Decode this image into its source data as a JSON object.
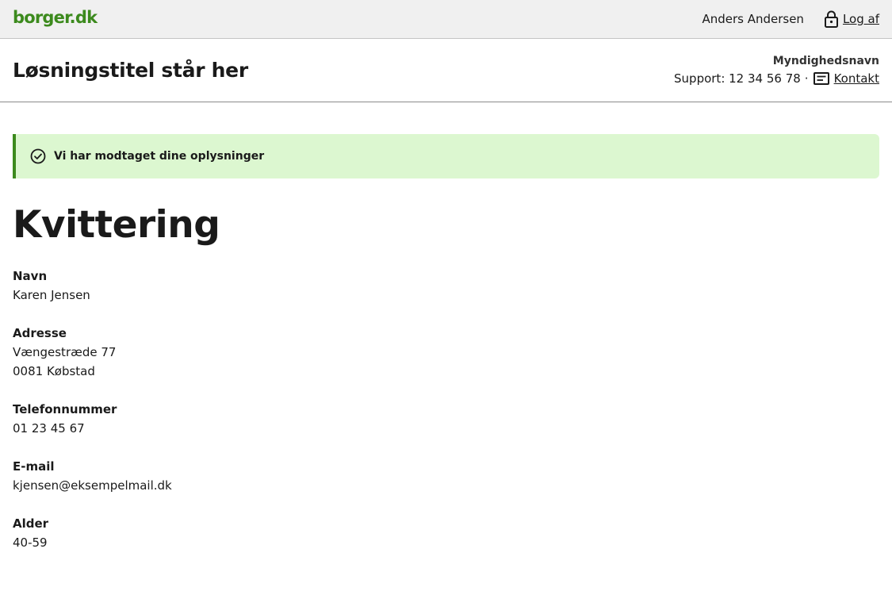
{
  "topbar": {
    "logo": "borger.dk",
    "user_name": "Anders Andersen",
    "logout_label": "Log af",
    "icons": {
      "logout": "lock-icon"
    }
  },
  "solution": {
    "title": "Løsningstitel står her",
    "authority_name": "Myndighedsnavn",
    "support_text": "Support: 12 34 56 78",
    "separator": "·",
    "contact_label": "Kontakt",
    "icons": {
      "contact": "message-icon"
    }
  },
  "alert": {
    "message": "Vi har modtaget dine oplysninger",
    "icon": "check-circle-icon",
    "background": "#dcf7d0",
    "accent": "#3c8a1d"
  },
  "page": {
    "heading": "Kvittering"
  },
  "fields": [
    {
      "label": "Navn",
      "lines": [
        "Karen Jensen"
      ]
    },
    {
      "label": "Adresse",
      "lines": [
        "Vængestræde 77",
        "0081 Købstad"
      ]
    },
    {
      "label": "Telefonnummer",
      "lines": [
        "01 23 45 67"
      ]
    },
    {
      "label": "E-mail",
      "lines": [
        "kjensen@eksempelmail.dk"
      ]
    },
    {
      "label": "Alder",
      "lines": [
        "40-59"
      ]
    }
  ],
  "colors": {
    "brand_green": "#3c8a1d",
    "topbar_bg": "#f0f0f0"
  }
}
